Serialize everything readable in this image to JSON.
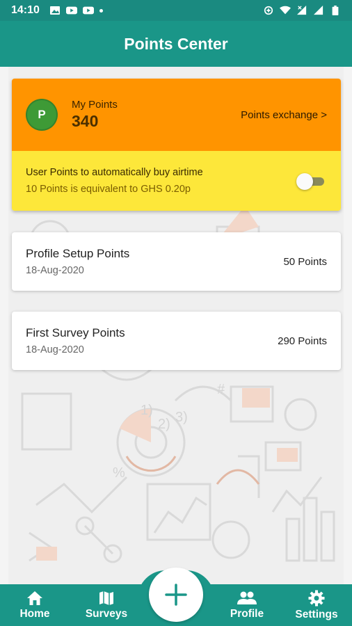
{
  "status_bar": {
    "time": "14:10",
    "icons_left": [
      "image-icon",
      "youtube-icon",
      "youtube-icon",
      "dot-icon"
    ],
    "icons_right": [
      "data-saver-icon",
      "wifi-icon",
      "signal-no-data-icon",
      "signal-icon",
      "battery-icon"
    ]
  },
  "app_bar": {
    "title": "Points Center"
  },
  "points_card": {
    "avatar_letter": "P",
    "label": "My Points",
    "value": "340",
    "exchange_link": "Points exchange >",
    "auto_buy_title": "User Points to automatically buy airtime",
    "auto_buy_rate": "10 Points is equivalent to GHS 0.20p",
    "auto_buy_enabled": false
  },
  "history": [
    {
      "title": "Profile Setup Points",
      "date": "18-Aug-2020",
      "amount": "50 Points"
    },
    {
      "title": "First Survey Points",
      "date": "18-Aug-2020",
      "amount": "290 Points"
    }
  ],
  "bottom_nav": {
    "items": [
      {
        "label": "Home",
        "icon": "home-icon"
      },
      {
        "label": "Surveys",
        "icon": "map-icon"
      },
      {
        "label": "Profile",
        "icon": "people-icon"
      },
      {
        "label": "Settings",
        "icon": "gear-icon"
      }
    ],
    "fab_icon": "plus-icon"
  },
  "colors": {
    "primary": "#1a9688",
    "points_orange": "#ff9400",
    "points_yellow": "#fde73a",
    "avatar_green": "#3e9a36"
  }
}
